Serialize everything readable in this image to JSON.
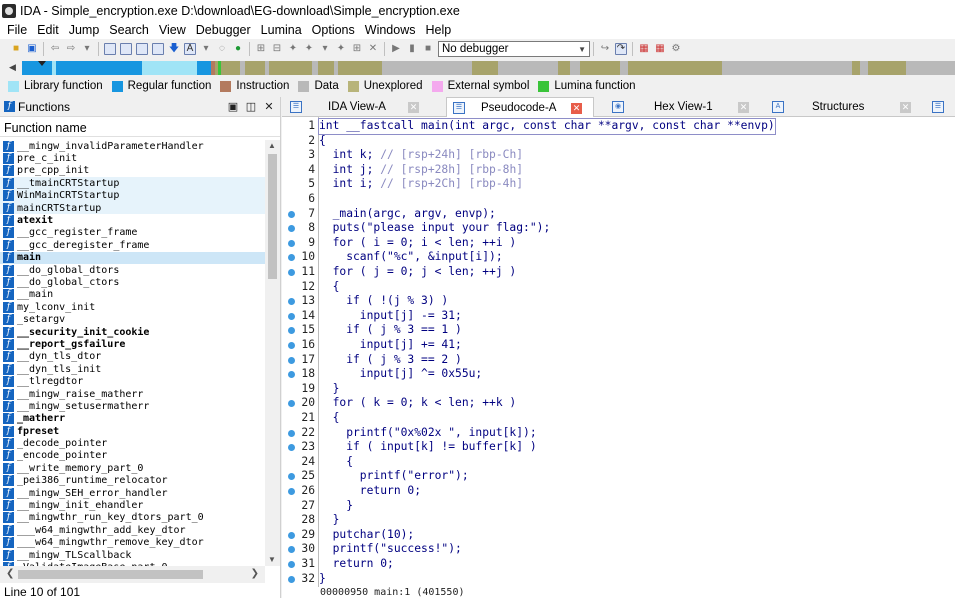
{
  "window": {
    "title": "IDA - Simple_encryption.exe D:\\download\\EG-download\\Simple_encryption.exe"
  },
  "menu": [
    "File",
    "Edit",
    "Jump",
    "Search",
    "View",
    "Debugger",
    "Lumina",
    "Options",
    "Windows",
    "Help"
  ],
  "toolbar": {
    "debugger_select": "No debugger"
  },
  "legend": [
    {
      "label": "Library function",
      "color": "#a0e4f6"
    },
    {
      "label": "Regular function",
      "color": "#1796e0"
    },
    {
      "label": "Instruction",
      "color": "#b37a5e"
    },
    {
      "label": "Data",
      "color": "#b9b9b9"
    },
    {
      "label": "Unexplored",
      "color": "#b8b47a"
    },
    {
      "label": "External symbol",
      "color": "#f4a9ee"
    },
    {
      "label": "Lumina function",
      "color": "#3ac43a"
    }
  ],
  "functions": {
    "title": "Functions",
    "column": "Function name",
    "status": "Line 10 of 101",
    "items": [
      {
        "name": "__mingw_invalidParameterHandler"
      },
      {
        "name": "pre_c_init"
      },
      {
        "name": "pre_cpp_init"
      },
      {
        "name": "__tmainCRTStartup",
        "hl": true
      },
      {
        "name": "WinMainCRTStartup",
        "hl": true
      },
      {
        "name": "mainCRTStartup",
        "hl": true
      },
      {
        "name": "atexit",
        "bold": true
      },
      {
        "name": "__gcc_register_frame"
      },
      {
        "name": "__gcc_deregister_frame"
      },
      {
        "name": "main",
        "bold": true,
        "sel": true
      },
      {
        "name": "__do_global_dtors"
      },
      {
        "name": "__do_global_ctors"
      },
      {
        "name": "__main"
      },
      {
        "name": "my_lconv_init"
      },
      {
        "name": "_setargv"
      },
      {
        "name": "__security_init_cookie",
        "bold": true
      },
      {
        "name": "__report_gsfailure",
        "bold": true
      },
      {
        "name": "__dyn_tls_dtor"
      },
      {
        "name": "__dyn_tls_init"
      },
      {
        "name": "__tlregdtor"
      },
      {
        "name": "__mingw_raise_matherr"
      },
      {
        "name": "__mingw_setusermatherr"
      },
      {
        "name": "_matherr",
        "bold": true
      },
      {
        "name": "fpreset",
        "bold": true
      },
      {
        "name": "_decode_pointer"
      },
      {
        "name": "_encode_pointer"
      },
      {
        "name": "__write_memory_part_0"
      },
      {
        "name": "_pei386_runtime_relocator"
      },
      {
        "name": "__mingw_SEH_error_handler"
      },
      {
        "name": "__mingw_init_ehandler"
      },
      {
        "name": "__mingwthr_run_key_dtors_part_0"
      },
      {
        "name": "___w64_mingwthr_add_key_dtor"
      },
      {
        "name": "___w64_mingwthr_remove_key_dtor"
      },
      {
        "name": "__mingw_TLScallback"
      },
      {
        "name": "_ValidateImageBase_part_0"
      }
    ]
  },
  "tabs": [
    {
      "label": "IDA View-A",
      "active": false
    },
    {
      "label": "Pseudocode-A",
      "active": true
    },
    {
      "label": "Hex View-1",
      "active": false
    },
    {
      "label": "Structures",
      "active": false
    }
  ],
  "code": {
    "lines": [
      {
        "n": "1",
        "dot": false,
        "cur": true,
        "text": "int __fastcall main(int argc, const char **argv, const char **envp)"
      },
      {
        "n": "2",
        "dot": false,
        "text": "{"
      },
      {
        "n": "3",
        "dot": false,
        "text": "  int k; // [rsp+24h] [rbp-Ch]"
      },
      {
        "n": "4",
        "dot": false,
        "text": "  int j; // [rsp+28h] [rbp-8h]"
      },
      {
        "n": "5",
        "dot": false,
        "text": "  int i; // [rsp+2Ch] [rbp-4h]"
      },
      {
        "n": "6",
        "dot": false,
        "text": ""
      },
      {
        "n": "7",
        "dot": true,
        "text": "  _main(argc, argv, envp);"
      },
      {
        "n": "8",
        "dot": true,
        "text": "  puts(\"please input your flag:\");"
      },
      {
        "n": "9",
        "dot": true,
        "text": "  for ( i = 0; i < len; ++i )"
      },
      {
        "n": "10",
        "dot": true,
        "text": "    scanf(\"%c\", &input[i]);"
      },
      {
        "n": "11",
        "dot": true,
        "text": "  for ( j = 0; j < len; ++j )"
      },
      {
        "n": "12",
        "dot": false,
        "text": "  {"
      },
      {
        "n": "13",
        "dot": true,
        "text": "    if ( !(j % 3) )"
      },
      {
        "n": "14",
        "dot": true,
        "text": "      input[j] -= 31;"
      },
      {
        "n": "15",
        "dot": true,
        "text": "    if ( j % 3 == 1 )"
      },
      {
        "n": "16",
        "dot": true,
        "text": "      input[j] += 41;"
      },
      {
        "n": "17",
        "dot": true,
        "text": "    if ( j % 3 == 2 )"
      },
      {
        "n": "18",
        "dot": true,
        "text": "      input[j] ^= 0x55u;"
      },
      {
        "n": "19",
        "dot": false,
        "text": "  }"
      },
      {
        "n": "20",
        "dot": true,
        "text": "  for ( k = 0; k < len; ++k )"
      },
      {
        "n": "21",
        "dot": false,
        "text": "  {"
      },
      {
        "n": "22",
        "dot": true,
        "text": "    printf(\"0x%02x \", input[k]);"
      },
      {
        "n": "23",
        "dot": true,
        "text": "    if ( input[k] != buffer[k] )"
      },
      {
        "n": "24",
        "dot": false,
        "text": "    {"
      },
      {
        "n": "25",
        "dot": true,
        "text": "      printf(\"error\");"
      },
      {
        "n": "26",
        "dot": true,
        "text": "      return 0;"
      },
      {
        "n": "27",
        "dot": false,
        "text": "    }"
      },
      {
        "n": "28",
        "dot": false,
        "text": "  }"
      },
      {
        "n": "29",
        "dot": true,
        "text": "  putchar(10);"
      },
      {
        "n": "30",
        "dot": true,
        "text": "  printf(\"success!\");"
      },
      {
        "n": "31",
        "dot": true,
        "text": "  return 0;"
      },
      {
        "n": "32",
        "dot": true,
        "text": "}"
      }
    ],
    "status": "00000950 main:1 (401550)"
  }
}
